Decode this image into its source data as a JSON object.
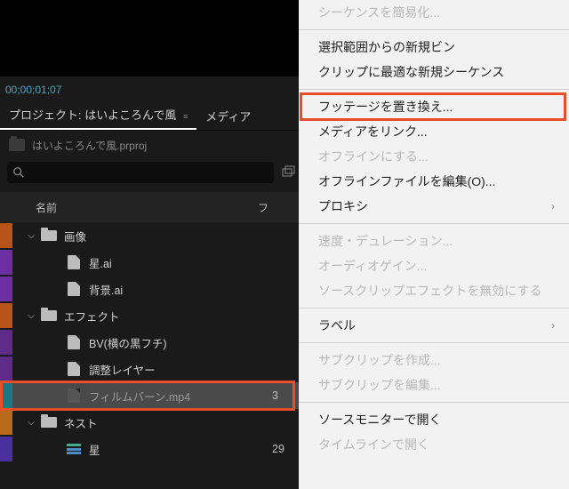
{
  "timecode": "00;00;01;07",
  "tabs": {
    "project_prefix": "プロジェクト:",
    "project_name": "はいよころんで風",
    "media": "メディア"
  },
  "project_file": "はいよころんで風.prproj",
  "columns": {
    "name": "名前",
    "fr": "フ"
  },
  "tree": [
    {
      "chip": "orange",
      "depth": 0,
      "kind": "folder",
      "open": true,
      "label": "画像"
    },
    {
      "chip": "violet",
      "depth": 1,
      "kind": "file",
      "label": "星.ai"
    },
    {
      "chip": "violet",
      "depth": 1,
      "kind": "file",
      "label": "背景.ai"
    },
    {
      "chip": "orange",
      "depth": 0,
      "kind": "folder",
      "open": true,
      "label": "エフェクト"
    },
    {
      "chip": "purple",
      "depth": 1,
      "kind": "file",
      "label": "BV(横の黒フチ)"
    },
    {
      "chip": "purple",
      "depth": 1,
      "kind": "file",
      "label": "調整レイヤー"
    },
    {
      "chip": "teal",
      "depth": 1,
      "kind": "file-dark",
      "sel": true,
      "label": "フィルムバーン.mp4",
      "meta": "3"
    },
    {
      "chip": "mango",
      "depth": 0,
      "kind": "folder",
      "open": true,
      "label": "ネスト"
    },
    {
      "chip": "iris",
      "depth": 1,
      "kind": "seq",
      "label": "星",
      "meta": "29"
    }
  ],
  "menu": [
    {
      "label": "シーケンスを簡易化...",
      "disabled": true
    },
    {
      "sep": true
    },
    {
      "label": "選択範囲からの新規ビン"
    },
    {
      "label": "クリップに最適な新規シーケンス"
    },
    {
      "sep": true
    },
    {
      "label": "フッテージを置き換え...",
      "highlight": true
    },
    {
      "label": "メディアをリンク..."
    },
    {
      "label": "オフラインにする...",
      "disabled": true
    },
    {
      "label": "オフラインファイルを編集(O)..."
    },
    {
      "label": "プロキシ",
      "submenu": true
    },
    {
      "sep": true
    },
    {
      "label": "速度・デュレーション...",
      "disabled": true
    },
    {
      "label": "オーディオゲイン...",
      "disabled": true
    },
    {
      "label": "ソースクリップエフェクトを無効にする",
      "disabled": true
    },
    {
      "sep": true
    },
    {
      "label": "ラベル",
      "submenu": true
    },
    {
      "sep": true
    },
    {
      "label": "サブクリップを作成...",
      "disabled": true
    },
    {
      "label": "サブクリップを編集...",
      "disabled": true
    },
    {
      "sep": true
    },
    {
      "label": "ソースモニターで開く"
    },
    {
      "label": "タイムラインで開く",
      "disabled": true
    }
  ]
}
